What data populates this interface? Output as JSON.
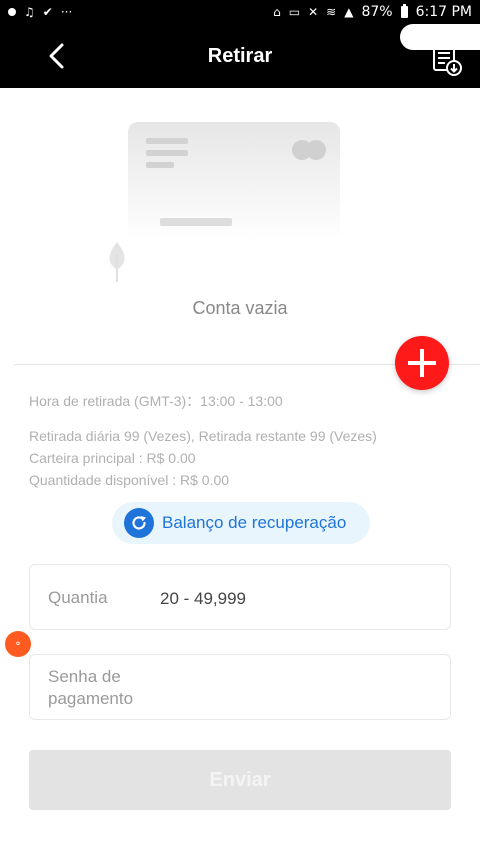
{
  "status_bar": {
    "battery": "87%",
    "time": "6:17 PM"
  },
  "header": {
    "title": "Retirar"
  },
  "empty_state": {
    "text": "Conta vazia"
  },
  "info": {
    "withdraw_time": "Hora de retirada (GMT-3)：13:00 - 13:00",
    "daily_limit": "Retirada diária 99 (Vezes), Retirada restante 99 (Vezes)",
    "main_wallet": "Carteira principal : R$ 0.00",
    "available_amount": "Quantidade disponível : R$ 0.00"
  },
  "refresh": {
    "label": "Balanço de recuperação"
  },
  "form": {
    "amount_label": "Quantia",
    "amount_placeholder": "20 - 49,999",
    "password_label": "Senha de pagamento",
    "password_value": ""
  },
  "submit": {
    "label": "Enviar"
  },
  "colors": {
    "header_bg": "#000000",
    "accent_blue": "#1e74d8",
    "add_red": "#ff1a1a",
    "disabled_button": "#e3e3e3"
  }
}
